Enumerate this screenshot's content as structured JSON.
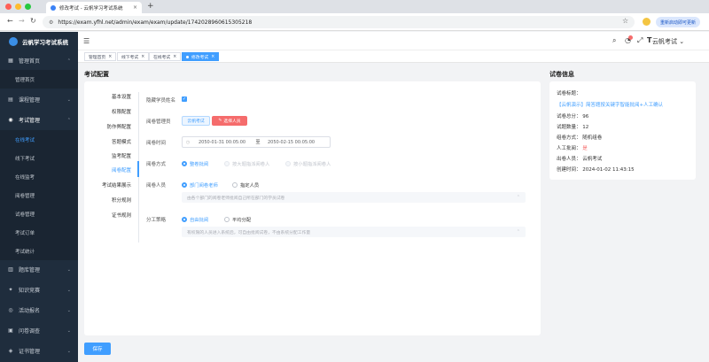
{
  "browser": {
    "tab_title": "修改考试 - 云帆学习考试系统",
    "url": "https://exam.yfhl.net/admin/exam/exam/update/1742028960615305218",
    "update_button": "重新启动即可更新"
  },
  "sidebar": {
    "brand": "云帆学习考试系统",
    "items": [
      {
        "label": "管理首页",
        "icon": "dashboard-icon"
      },
      {
        "label": "管理首页",
        "sub": true
      },
      {
        "label": "课程管理",
        "icon": "book-icon"
      },
      {
        "label": "考试管理",
        "icon": "exam-icon"
      },
      {
        "label": "在线考试",
        "sub": true,
        "active": true
      },
      {
        "label": "线下考试",
        "sub": true
      },
      {
        "label": "在线监考",
        "sub": true
      },
      {
        "label": "阅卷管理",
        "sub": true
      },
      {
        "label": "试卷管理",
        "sub": true
      },
      {
        "label": "考试订单",
        "sub": true
      },
      {
        "label": "考试统计",
        "sub": true
      },
      {
        "label": "题库管理",
        "icon": "question-bank-icon"
      },
      {
        "label": "知识竞赛",
        "icon": "contest-icon"
      },
      {
        "label": "活动报名",
        "icon": "signup-icon"
      },
      {
        "label": "问卷调查",
        "icon": "survey-icon"
      },
      {
        "label": "证书管理",
        "icon": "certificate-icon"
      }
    ]
  },
  "topbar": {
    "username": "云帆考试"
  },
  "tags": [
    {
      "label": "管理首页"
    },
    {
      "label": "线下考试"
    },
    {
      "label": "在线考试"
    },
    {
      "label": "修改考试",
      "active": true
    }
  ],
  "main": {
    "section_title": "考试配置",
    "steps": [
      "基本设置",
      "权限配置",
      "防作弊配置",
      "答题模式",
      "监考配置",
      "阅卷配置",
      "考试结果展示",
      "积分规则",
      "证书规则"
    ],
    "form": {
      "hide_name_label": "隐藏学员姓名",
      "grader_label": "阅卷管理员",
      "grader_tag": "云帆考试",
      "select_person_btn": "选择人员",
      "grade_time_label": "阅卷时间",
      "grade_start": "2050-01-31 00:05:00",
      "grade_to": "至",
      "grade_end": "2050-02-15 00:05:00",
      "grade_mode_label": "阅卷方式",
      "grade_mode_options": [
        "整卷批阅",
        "按大题指派阅卷人",
        "按小题指派阅卷人"
      ],
      "grader_person_label": "阅卷人员",
      "grader_person_options": [
        "部门阅卷老师",
        "指定人员"
      ],
      "grader_person_hint": "由各个部门的阅卷老师批阅自己所在部门的学员试卷",
      "division_label": "分工策略",
      "division_options": [
        "自由批阅",
        "平均分配"
      ],
      "division_hint": "有权限的人员进入系统后，可自由批阅试卷，不由系统分配工作量"
    },
    "save_button": "保存"
  },
  "info": {
    "title": "试卷信息",
    "paper_title_label": "试卷标题：",
    "paper_title": "【云帆演示】简答题按关键字智能批阅+人工确认",
    "total_score": "试卷总分：  96",
    "question_count": "试题数量：  12",
    "compose_method": "组卷方式：  随机组卷",
    "manual_grading_label": "人工批阅：",
    "manual_grading_value": "是",
    "author": "出卷人员：  云帆考试",
    "created": "创建时间：  2024-01-02 11:43:15"
  },
  "colors": {
    "primary": "#409eff",
    "danger": "#f56c6c",
    "sidebar": "#1f2d3d"
  }
}
